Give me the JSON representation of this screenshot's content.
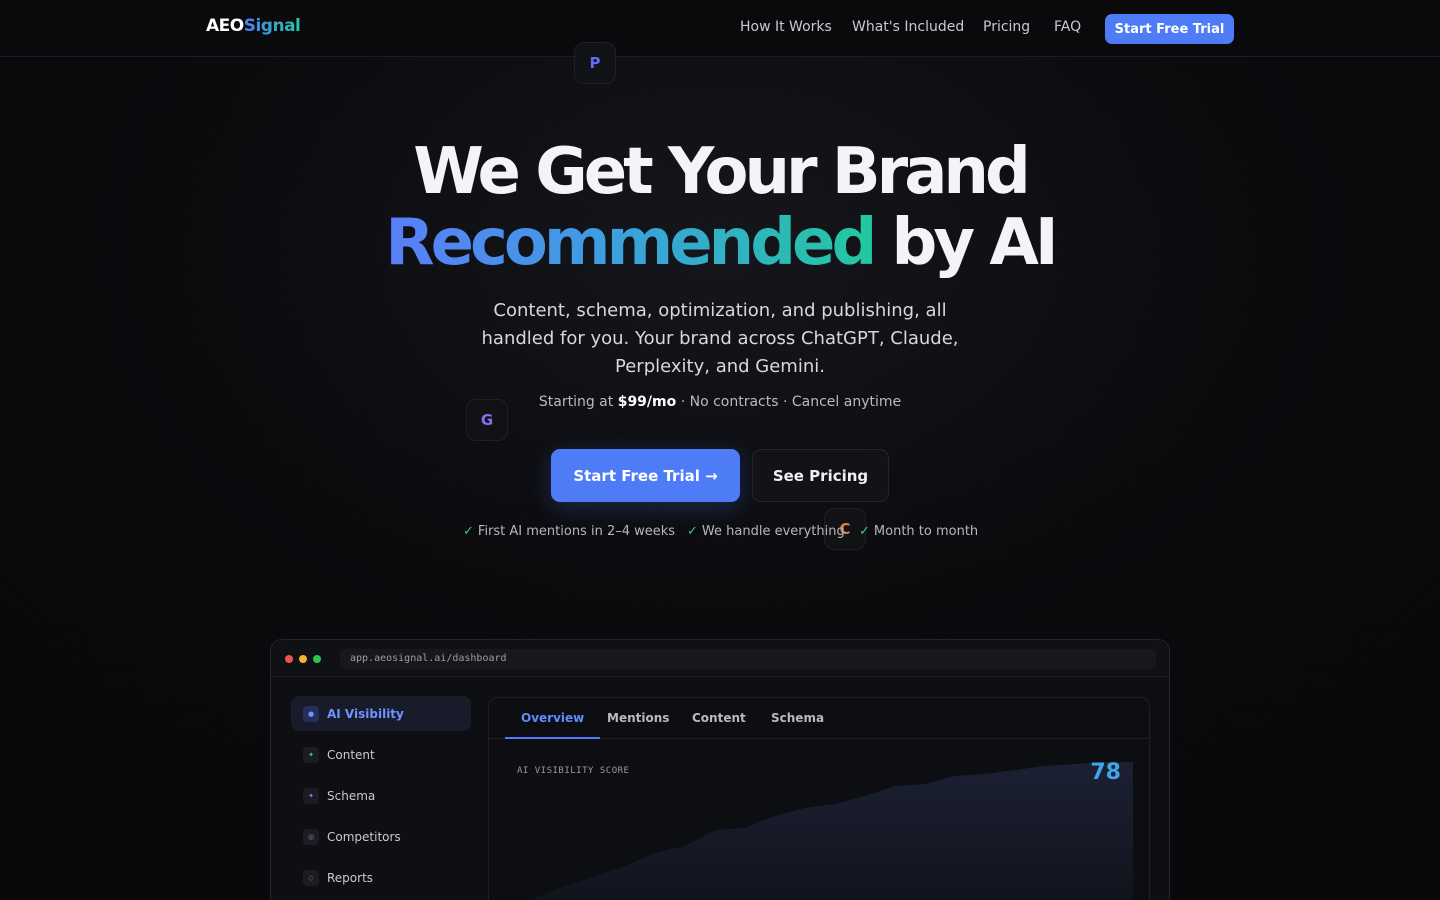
{
  "nav": {
    "logo_a": "AEO",
    "logo_b": "Signal",
    "links": [
      "How It Works",
      "What's Included",
      "Pricing",
      "FAQ"
    ],
    "cta": "Start Free Trial"
  },
  "floating_icons": [
    "P",
    "G",
    "C"
  ],
  "hero": {
    "title_line1": "We Get Your Brand",
    "title_grad": "Recommended",
    "title_line2_rest": " by AI",
    "subtitle": "Content, schema, optimization, and publishing, all handled for you. Your brand across ChatGPT, Claude, Perplexity, and Gemini.",
    "pricing_prefix": "Starting at ",
    "pricing_price": "$99/mo",
    "pricing_suffix": " · No contracts · Cancel anytime",
    "primary_cta": "Start Free Trial →",
    "secondary_cta": "See Pricing",
    "checks": [
      "First AI mentions in 2–4 weeks",
      "We handle everything",
      "Month to month"
    ]
  },
  "dashboard": {
    "url": "app.aeosignal.ai/dashboard",
    "sidebar": [
      {
        "label": "AI Visibility",
        "icon": "●",
        "active": true
      },
      {
        "label": "Content",
        "icon": "✦"
      },
      {
        "label": "Schema",
        "icon": "✦"
      },
      {
        "label": "Competitors",
        "icon": "◎"
      },
      {
        "label": "Reports",
        "icon": "◇"
      }
    ],
    "tabs": [
      "Overview",
      "Mentions",
      "Content",
      "Schema"
    ],
    "score_label": "AI VISIBILITY SCORE",
    "score_value": "78"
  },
  "colors": {
    "accent": "#4d7cf6",
    "gradient_start": "#5a7ef8",
    "gradient_end": "#24c8a0",
    "check": "#2bd37a"
  }
}
